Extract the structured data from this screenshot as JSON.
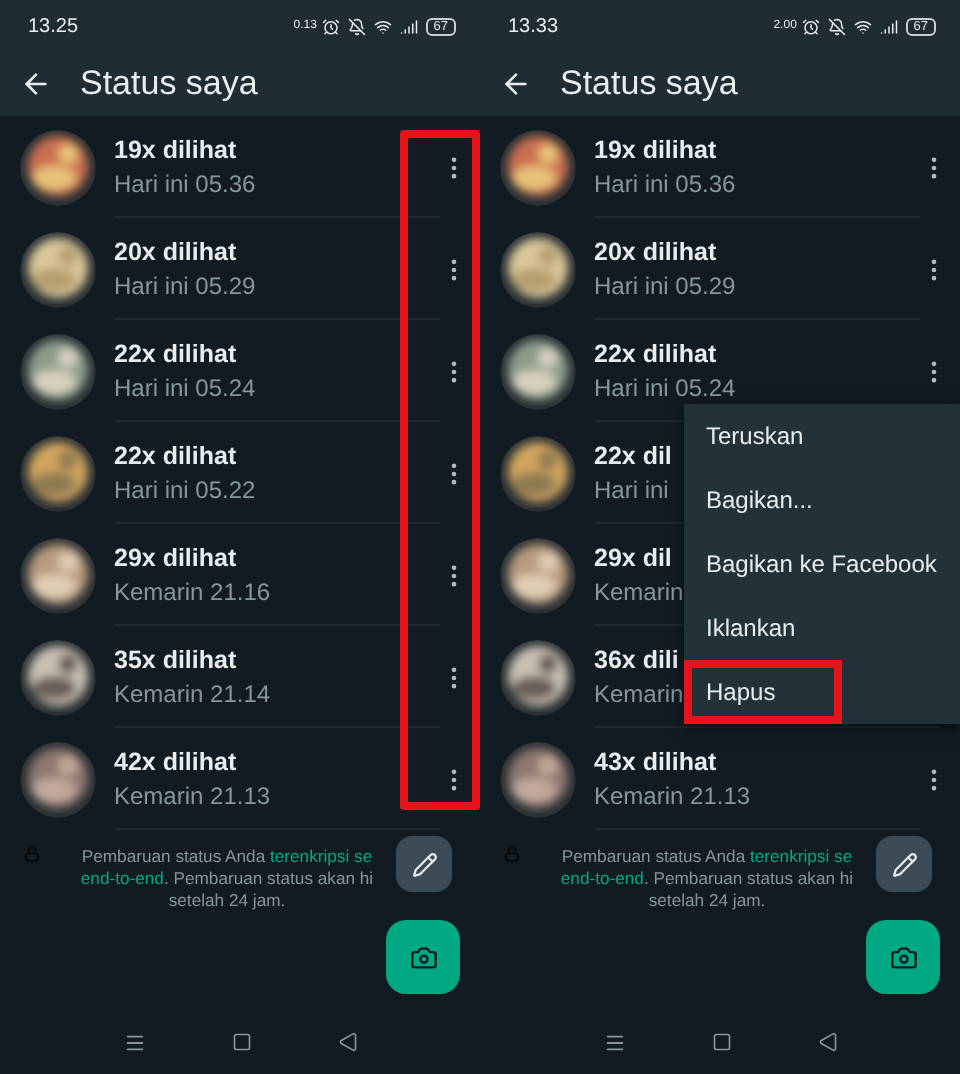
{
  "panels": [
    {
      "status_bar": {
        "time": "13.25",
        "speed": "0.13",
        "battery": "67"
      },
      "title": "Status saya",
      "highlight_menus": true,
      "rows": [
        {
          "views": "19x dilihat",
          "time": "Hari ini 05.36",
          "menu_visible": true
        },
        {
          "views": "20x dilihat",
          "time": "Hari ini 05.29",
          "menu_visible": true
        },
        {
          "views": "22x dilihat",
          "time": "Hari ini 05.24",
          "menu_visible": true
        },
        {
          "views": "22x dilihat",
          "time": "Hari ini 05.22",
          "menu_visible": true
        },
        {
          "views": "29x dilihat",
          "time": "Kemarin 21.16",
          "menu_visible": true
        },
        {
          "views": "35x dilihat",
          "time": "Kemarin 21.14",
          "menu_visible": true
        },
        {
          "views": "42x dilihat",
          "time": "Kemarin 21.13",
          "menu_visible": true
        }
      ],
      "notice": [
        [
          {
            "kind": "text",
            "text": "Pembaruan status Anda "
          },
          {
            "kind": "link",
            "text": "terenkripsi se"
          }
        ],
        [
          {
            "kind": "link",
            "text": "end-to-end"
          },
          {
            "kind": "text",
            "text": ". Pembaruan status akan hi"
          }
        ],
        [
          {
            "kind": "text",
            "text": "setelah 24 jam."
          }
        ]
      ]
    },
    {
      "status_bar": {
        "time": "13.33",
        "speed": "2.00",
        "battery": "67"
      },
      "title": "Status saya",
      "highlight_menus": false,
      "rows": [
        {
          "views": "19x dilihat",
          "time": "Hari ini 05.36",
          "menu_visible": true
        },
        {
          "views": "20x dilihat",
          "time": "Hari ini 05.29",
          "menu_visible": true
        },
        {
          "views": "22x dilihat",
          "time": "Hari ini 05.24",
          "menu_visible": true
        },
        {
          "views": "22x dil",
          "time": "Hari ini",
          "menu_visible": false
        },
        {
          "views": "29x dil",
          "time": "Kemarin",
          "menu_visible": false
        },
        {
          "views": "36x dili",
          "time": "Kemarin",
          "menu_visible": false
        },
        {
          "views": "43x dilihat",
          "time": "Kemarin 21.13",
          "menu_visible": true
        }
      ],
      "popup_menu": [
        {
          "label": "Teruskan",
          "highlighted": false
        },
        {
          "label": "Bagikan...",
          "highlighted": false
        },
        {
          "label": "Bagikan ke Facebook",
          "highlighted": false
        },
        {
          "label": "Iklankan",
          "highlighted": false
        },
        {
          "label": "Hapus",
          "highlighted": true
        }
      ],
      "notice": [
        [
          {
            "kind": "text",
            "text": "Pembaruan status Anda "
          },
          {
            "kind": "link",
            "text": "terenkripsi se"
          }
        ],
        [
          {
            "kind": "link",
            "text": "end-to-end"
          },
          {
            "kind": "text",
            "text": ". Pembaruan status akan hi"
          }
        ],
        [
          {
            "kind": "text",
            "text": "setelah 24 jam."
          }
        ]
      ]
    }
  ]
}
